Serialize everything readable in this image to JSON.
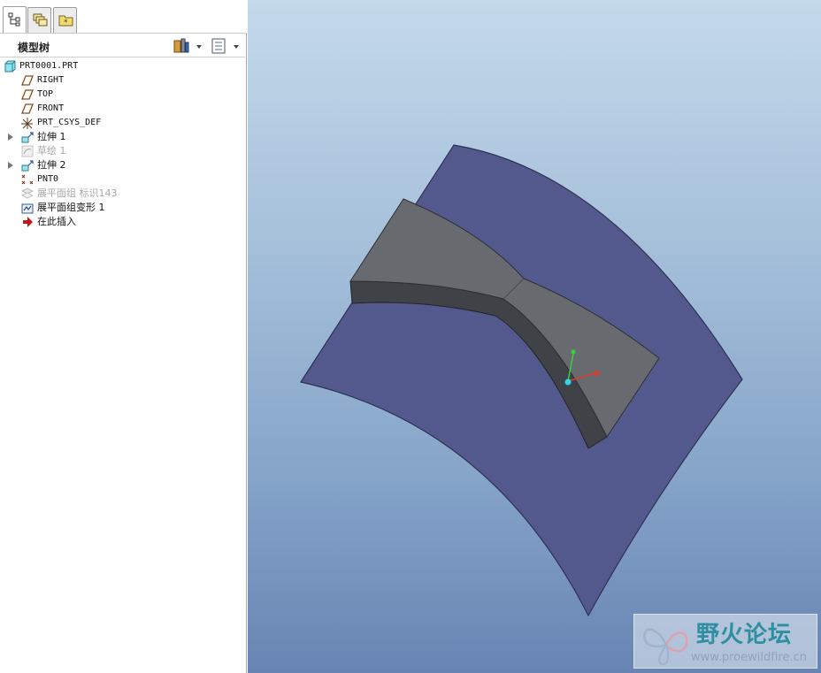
{
  "left_panel": {
    "tabs": [
      {
        "icon": "model-tree-icon"
      },
      {
        "icon": "layers-icon"
      },
      {
        "icon": "favorites-folder-icon"
      }
    ],
    "title": "模型树",
    "tools": [
      {
        "icon": "tree-settings-icon"
      },
      {
        "icon": "tree-columns-icon"
      }
    ]
  },
  "tree": {
    "items": [
      {
        "label": "PRT0001.PRT",
        "icon": "part-icon",
        "level": 0,
        "expandable": false,
        "dim": false
      },
      {
        "label": "RIGHT",
        "icon": "datum-plane-icon",
        "level": 1,
        "expandable": false,
        "dim": false
      },
      {
        "label": "TOP",
        "icon": "datum-plane-icon",
        "level": 1,
        "expandable": false,
        "dim": false
      },
      {
        "label": "FRONT",
        "icon": "datum-plane-icon",
        "level": 1,
        "expandable": false,
        "dim": false
      },
      {
        "label": "PRT_CSYS_DEF",
        "icon": "coordinate-system-icon",
        "level": 1,
        "expandable": false,
        "dim": false
      },
      {
        "label": "拉伸 1",
        "icon": "extrude-icon",
        "level": 1,
        "expandable": true,
        "dim": false
      },
      {
        "label": "草绘 1",
        "icon": "sketch-icon",
        "level": 1,
        "expandable": false,
        "dim": true
      },
      {
        "label": "拉伸 2",
        "icon": "extrude-icon",
        "level": 1,
        "expandable": true,
        "dim": false
      },
      {
        "label": "PNT0",
        "icon": "datum-point-icon",
        "level": 1,
        "expandable": false,
        "dim": false
      },
      {
        "label": "展平面组 标识143",
        "icon": "flatten-quilt-icon",
        "level": 1,
        "expandable": false,
        "dim": true
      },
      {
        "label": "展平面组变形 1",
        "icon": "flatten-deform-icon",
        "level": 1,
        "expandable": false,
        "dim": false
      },
      {
        "label": "在此插入",
        "icon": "insert-here-arrow-icon",
        "level": 1,
        "expandable": false,
        "dim": false
      }
    ]
  },
  "viewport": {
    "colors": {
      "surface": "#53598c",
      "solid_top": "#676b70",
      "solid_side": "#3f4247",
      "axis_x": "#e03a2a",
      "axis_y": "#3ad13a",
      "axis_z": "#32d6e6"
    }
  },
  "watermark": {
    "title": "野火论坛",
    "url": "www.proewildfire.cn"
  }
}
